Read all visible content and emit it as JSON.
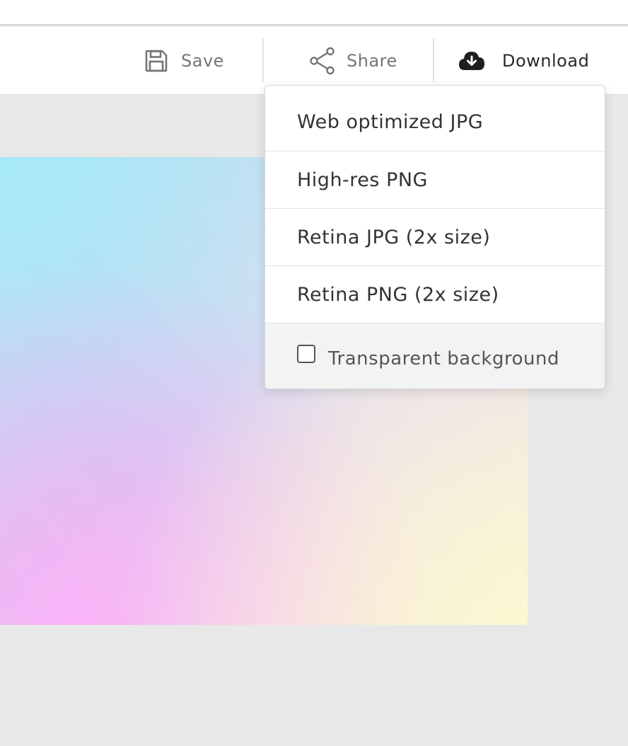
{
  "toolbar": {
    "save": {
      "label": "Save",
      "icon": "floppy-disk-icon"
    },
    "share": {
      "label": "Share",
      "icon": "share-nodes-icon"
    },
    "download": {
      "label": "Download",
      "icon": "cloud-download-icon"
    }
  },
  "download_menu": {
    "items": [
      {
        "label": "Web optimized JPG"
      },
      {
        "label": "High-res PNG"
      },
      {
        "label": "Retina JPG (2x size)"
      },
      {
        "label": "Retina PNG (2x size)"
      }
    ],
    "transparent_background": {
      "label": "Transparent background",
      "checked": false
    }
  },
  "colors": {
    "toolbar_text": "#757575",
    "download_text": "#2a2a2a",
    "menu_text": "#333333",
    "workspace_bg": "#e8e8e8"
  }
}
